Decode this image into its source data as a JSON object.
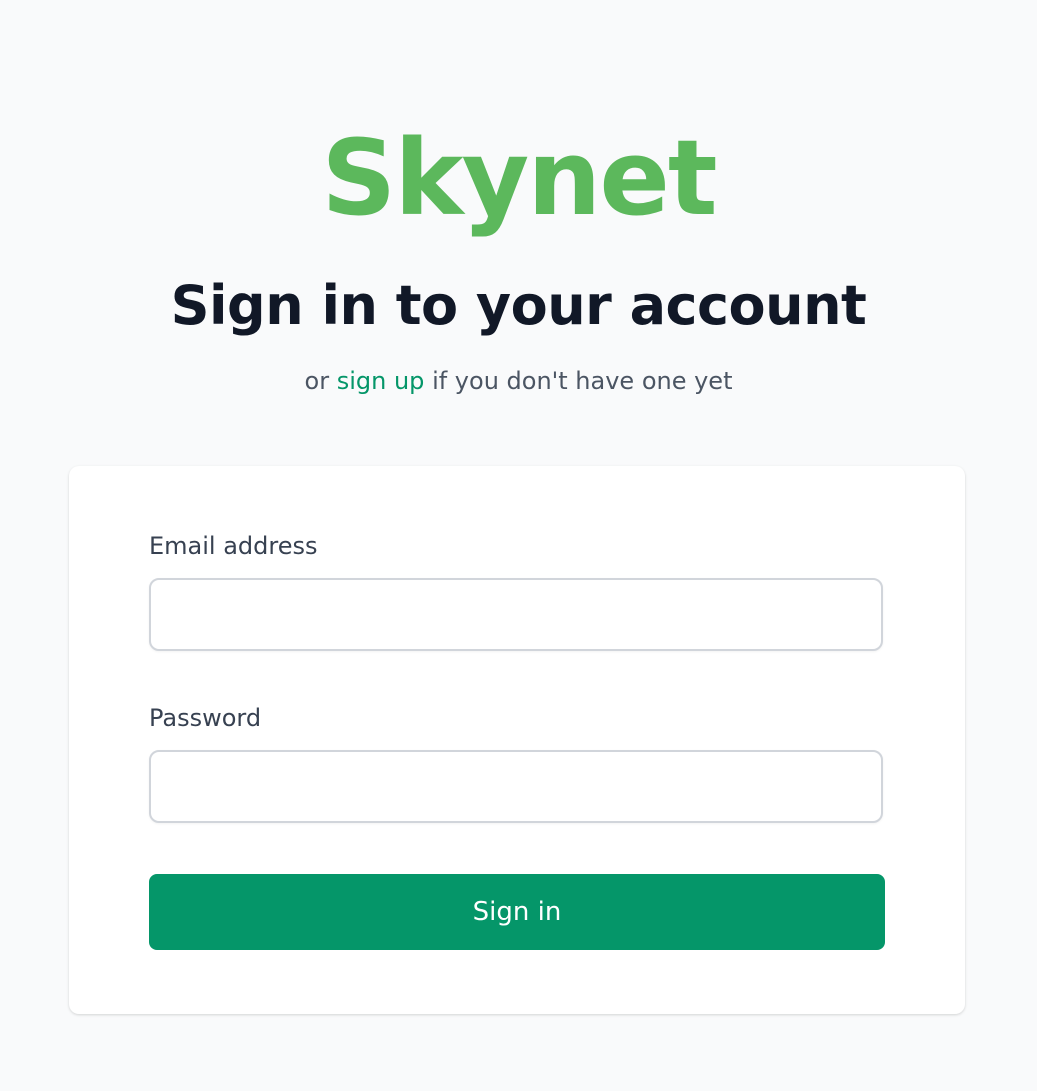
{
  "brand": {
    "logo_text": "Skynet",
    "logo_color": "#5cb85c"
  },
  "header": {
    "title": "Sign in to your account",
    "subtitle_prefix": "or",
    "signup_link": "sign up",
    "subtitle_suffix": "if you don't have one yet"
  },
  "form": {
    "email_label": "Email address",
    "email_value": "",
    "password_label": "Password",
    "password_value": "",
    "submit_label": "Sign in"
  },
  "colors": {
    "accent": "#059669",
    "background": "#f9fafb",
    "card": "#ffffff"
  }
}
